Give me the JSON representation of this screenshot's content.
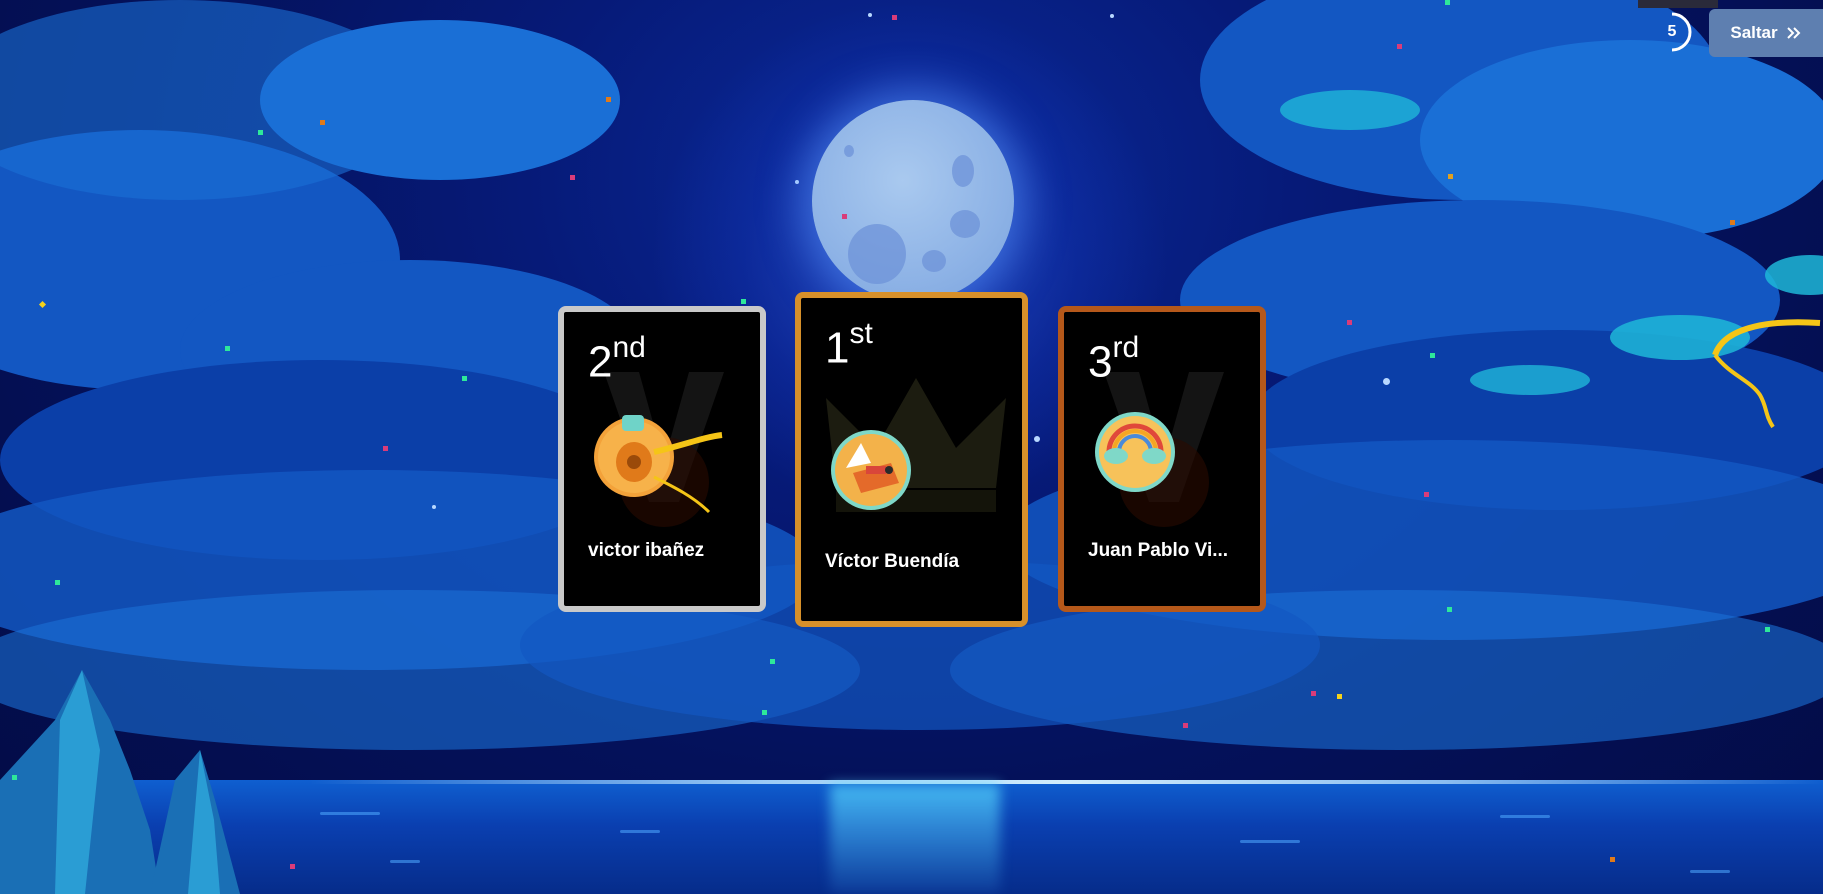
{
  "game": {
    "timer_value": "5",
    "skip_label": "Saltar",
    "podium": [
      {
        "rank_num": "2",
        "rank_suffix": "nd",
        "name": "victor ibañez"
      },
      {
        "rank_num": "1",
        "rank_suffix": "st",
        "name": "Víctor Buendía"
      },
      {
        "rank_num": "3",
        "rank_suffix": "rd",
        "name": "Juan Pablo Vi..."
      }
    ]
  },
  "colors": {
    "silver_frame": "#c9c9c9",
    "gold_frame": "#d7902a",
    "bronze_frame": "#b5581a",
    "skip_button_bg": "#5e7fb0"
  },
  "icons": {
    "avatar_second": "guitar-avatar-icon",
    "avatar_first": "fox-knight-avatar-icon",
    "avatar_third": "rainbow-cloud-avatar-icon",
    "skip": "double-chevron-right-icon",
    "timer": "countdown-ring-icon",
    "podium_watermark_first": "crown-watermark-icon",
    "podium_watermark_other": "laurel-v-watermark-icon"
  }
}
